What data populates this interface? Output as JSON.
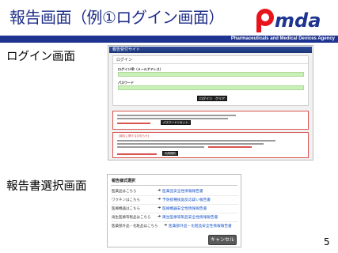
{
  "slide": {
    "title": "報告画面（例①ログイン画面）",
    "page_number": "5"
  },
  "logo": {
    "text": "Pmda",
    "tagline": "Pharmaceuticals and Medical Devices Agency",
    "accent_color": "#e8141c",
    "brand_color": "#1e3490"
  },
  "sections": {
    "login_label": "ログイン画面",
    "select_label": "報告書選択画面"
  },
  "login_screen": {
    "site_title": "報告受付サイト",
    "panel_title": "ログイン",
    "id_label": "ログインID（メールアドレス）",
    "password_label": "パスワード",
    "login_button": "ログイン",
    "clear_button": "クリア",
    "reset_password_button": "パスワードリセット",
    "notice2_heading": "【報告に関するお知らせ】",
    "notice2_button": "利用規約"
  },
  "select_screen": {
    "title": "報告様式選択",
    "rows": [
      {
        "label": "医薬品はこちら",
        "arrow": "➔",
        "link": "医薬品安全性情報報告書"
      },
      {
        "label": "ワクチンはこちら",
        "arrow": "➔",
        "link": "予防接種後副反応疑い報告書"
      },
      {
        "label": "医療機器はこちら",
        "arrow": "➔",
        "link": "医療機器安全性情報報告書"
      },
      {
        "label": "再生医療等製品はこちら",
        "arrow": "➔",
        "link": "再生医療等製品安全性情報報告書"
      },
      {
        "label": "医薬部外品・化粧品はこちら",
        "arrow": "➔",
        "link": "医薬部外品・化粧品安全性情報報告書"
      }
    ],
    "cancel_button": "キャンセル"
  }
}
